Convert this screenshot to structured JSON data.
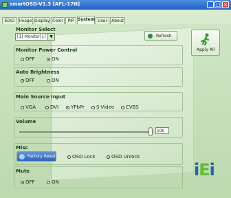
{
  "window": {
    "title": "smartOSD-V1.3 [AFL-17N]",
    "controls": {
      "minimize": "_",
      "maximize": "□",
      "close": "×"
    }
  },
  "tabs": [
    {
      "label": "EDID"
    },
    {
      "label": "Image"
    },
    {
      "label": "Display"
    },
    {
      "label": "Color"
    },
    {
      "label": "PIP"
    },
    {
      "label": "System"
    },
    {
      "label": "User"
    },
    {
      "label": "About"
    }
  ],
  "active_tab": "System",
  "monitor_select": {
    "label": "Monitor Select",
    "value": "[1] Monitor[1]",
    "refresh_label": "Refresh"
  },
  "apply_all": {
    "label": "Apply All"
  },
  "monitor_power": {
    "label": "Monitor Power Control",
    "options": [
      "OFF",
      "ON"
    ],
    "selected": "ON"
  },
  "auto_brightness": {
    "label": "Auto Brightness",
    "options": [
      "OFF",
      "ON"
    ],
    "selected": "OFF"
  },
  "main_source": {
    "label": "Main Source Input",
    "options": [
      "VGA",
      "DVI",
      "YPbPr",
      "S-Video",
      "CVBS"
    ],
    "selected": "YPbPr"
  },
  "volume": {
    "label": "Volume",
    "value": "100",
    "level_percent": 100
  },
  "misc": {
    "label": "Misc",
    "factory_reset": "Factory Reset",
    "osd_lock": "OSD Lock",
    "osd_unlock": "OSD Unlock",
    "selected": "OSD Unlock"
  },
  "mute": {
    "label": "Mute",
    "options": [
      "OFF",
      "ON"
    ],
    "selected": "OFF"
  },
  "logo": {
    "text_i1": "i",
    "text_e": "E",
    "text_i2": "i"
  },
  "colors": {
    "title_bar": "#1f5fc4",
    "panel": "#cfe6c4",
    "logo_blue": "#2f5fa8",
    "logo_green": "#5bbf2f"
  }
}
